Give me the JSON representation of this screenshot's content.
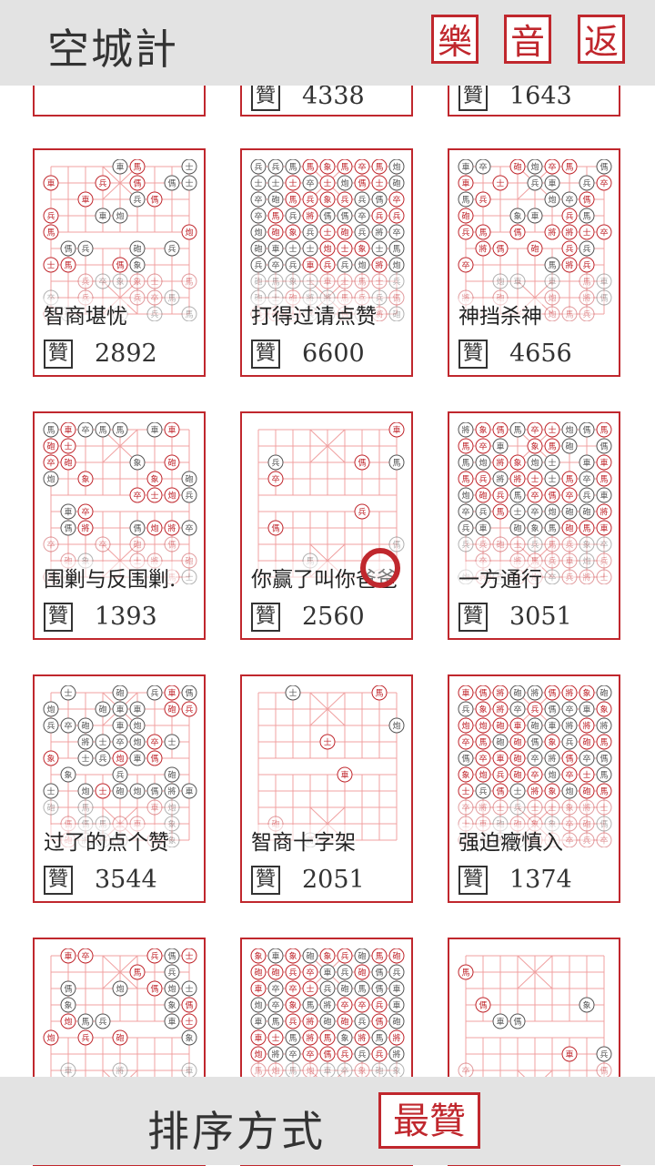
{
  "header": {
    "title": "空城計",
    "buttons": [
      "樂",
      "音",
      "返"
    ]
  },
  "footer": {
    "sort_label": "排序方式",
    "sort_value": "最贊"
  },
  "like_glyph": "贊",
  "colors": {
    "accent": "#c0272d",
    "chrome": "#e3e3e3"
  },
  "partial_top": [
    {
      "count": ""
    },
    {
      "count": "4338"
    },
    {
      "count": "1643"
    }
  ],
  "puzzles": [
    {
      "title": "智商堪忧",
      "likes": "2892",
      "density": 0.45
    },
    {
      "title": "打得过请点赞",
      "likes": "6600",
      "density": 1.0
    },
    {
      "title": "神挡杀神",
      "likes": "4656",
      "density": 0.5
    },
    {
      "title": "围剿与反围剿.",
      "likes": "1393",
      "density": 0.5
    },
    {
      "title": "你赢了叫你爸爸",
      "likes": "2560",
      "density": 0.1
    },
    {
      "title": "一方通行",
      "likes": "3051",
      "density": 0.95
    },
    {
      "title": "过了的点个赞",
      "likes": "3544",
      "density": 0.6
    },
    {
      "title": "智商十字架",
      "likes": "2051",
      "density": 0.1
    },
    {
      "title": "强迫癥慎入",
      "likes": "1374",
      "density": 1.0
    },
    {
      "title": "",
      "likes": "",
      "density": 0.35
    },
    {
      "title": "",
      "likes": "",
      "density": 1.0
    },
    {
      "title": "",
      "likes": "",
      "density": 0.15
    }
  ],
  "piece_glyphs": [
    "兵",
    "卒",
    "車",
    "馬",
    "炮",
    "象",
    "士",
    "將",
    "砲",
    "傌"
  ]
}
